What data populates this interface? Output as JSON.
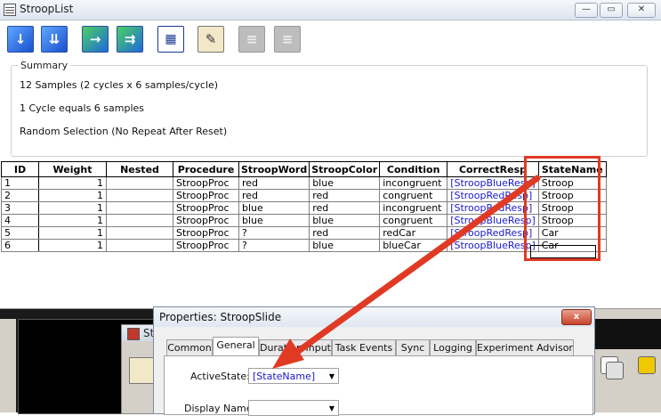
{
  "list_window": {
    "title": "StroopList",
    "controls": {
      "minimize": "—",
      "maximize": "▭",
      "close": "✕"
    },
    "toolbar": [
      {
        "icon": "add-level-icon",
        "glyph": "↓"
      },
      {
        "icon": "add-multiple-levels-icon",
        "glyph": "⇊"
      },
      {
        "icon": "add-attribute-icon",
        "glyph": "→"
      },
      {
        "icon": "add-multiple-attributes-icon",
        "glyph": "⇉"
      },
      {
        "icon": "grid-icon",
        "glyph": "▦"
      },
      {
        "icon": "properties-icon",
        "glyph": "✎"
      },
      {
        "icon": "remove-level-icon",
        "glyph": "≡"
      },
      {
        "icon": "remove-attribute-icon",
        "glyph": "≡"
      }
    ],
    "summary": {
      "legend": "Summary",
      "lines": [
        "12 Samples (2 cycles x 6 samples/cycle)",
        "1 Cycle equals 6 samples",
        "Random Selection  (No Repeat After Reset)"
      ]
    },
    "table": {
      "columns": [
        "ID",
        "Weight",
        "Nested",
        "Procedure",
        "StroopWord",
        "StroopColor",
        "Condition",
        "CorrectResp",
        "StateName"
      ],
      "rows": [
        [
          "1",
          "1",
          "",
          "StroopProc",
          "red",
          "blue",
          "incongruent",
          "[StroopBlueResp]",
          "Stroop"
        ],
        [
          "2",
          "1",
          "",
          "StroopProc",
          "red",
          "red",
          "congruent",
          "[StroopRedResp]",
          "Stroop"
        ],
        [
          "3",
          "1",
          "",
          "StroopProc",
          "blue",
          "red",
          "incongruent",
          "[StroopRedResp]",
          "Stroop"
        ],
        [
          "4",
          "1",
          "",
          "StroopProc",
          "blue",
          "blue",
          "congruent",
          "[StroopBlueResp]",
          "Stroop"
        ],
        [
          "5",
          "1",
          "",
          "StroopProc",
          "?",
          "red",
          "redCar",
          "[StroopRedResp]",
          "Car"
        ],
        [
          "6",
          "1",
          "",
          "StroopProc",
          "?",
          "blue",
          "blueCar",
          "[StroopBlueResp]",
          "Car"
        ]
      ]
    }
  },
  "background_window": {
    "title": "St"
  },
  "properties_dialog": {
    "title": "Properties: StroopSlide",
    "close": "x",
    "tabs": [
      "Common",
      "General",
      "Duration/Input",
      "Task Events",
      "Sync",
      "Logging",
      "Experiment Advisor"
    ],
    "active_tab": "General",
    "fields": {
      "active_state_label": "ActiveState:",
      "active_state_value": "[StateName]",
      "display_name_label": "Display Name:",
      "display_name_value": ""
    }
  },
  "colors": {
    "highlight": "#e03a24",
    "attribute_ref": "#1a1ad0"
  }
}
